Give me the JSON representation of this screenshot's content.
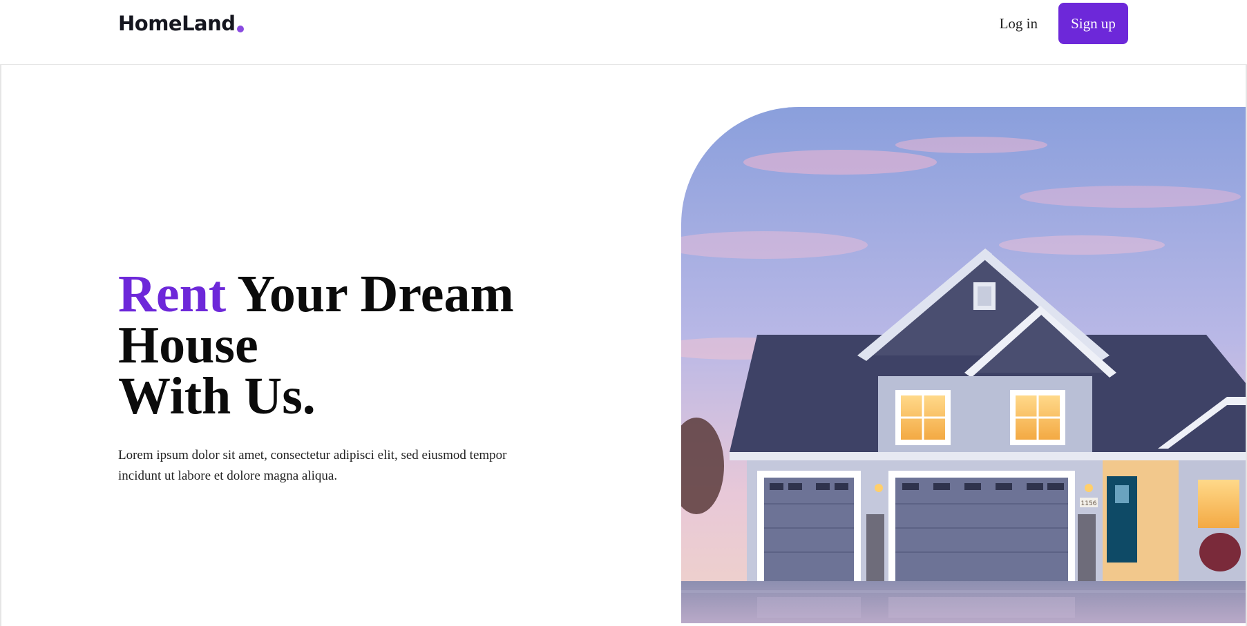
{
  "header": {
    "logo_text": "HomeLand",
    "login_label": "Log in",
    "signup_label": "Sign up"
  },
  "hero": {
    "title_accent": "Rent",
    "title_rest_line1": " Your Dream House",
    "title_line2": "With Us.",
    "description": "Lorem ipsum dolor sit amet, consectetur adipisci elit, sed eiusmod tempor incidunt ut labore et dolore magna aliqua.",
    "house_number": "1156"
  },
  "colors": {
    "accent": "#6d28d9",
    "logo_dot": "#8a4be0",
    "text": "#0b0b0b"
  }
}
